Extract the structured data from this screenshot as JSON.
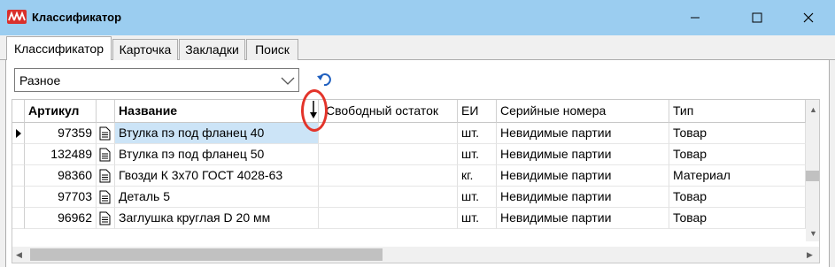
{
  "window": {
    "title": "Классификатор"
  },
  "tabs": [
    {
      "label": "Классификатор",
      "active": true
    },
    {
      "label": "Карточка",
      "active": false
    },
    {
      "label": "Закладки",
      "active": false
    },
    {
      "label": "Поиск",
      "active": false
    }
  ],
  "filter": {
    "selected": "Разное"
  },
  "grid": {
    "columns": [
      "Артикул",
      "",
      "Название",
      "Свободный остаток",
      "ЕИ",
      "Серийные номера",
      "Тип"
    ],
    "rows": [
      {
        "article": "97359",
        "name": "Втулка пэ под фланец 40",
        "stock": "",
        "unit": "шт.",
        "serial": "Невидимые партии",
        "type": "Товар",
        "current": true
      },
      {
        "article": "132489",
        "name": "Втулка пэ под фланец 50",
        "stock": "",
        "unit": "шт.",
        "serial": "Невидимые партии",
        "type": "Товар",
        "current": false
      },
      {
        "article": "98360",
        "name": "Гвозди К 3х70 ГОСТ 4028-63",
        "stock": "",
        "unit": "кг.",
        "serial": "Невидимые партии",
        "type": "Материал",
        "current": false
      },
      {
        "article": "97703",
        "name": "Деталь 5",
        "stock": "",
        "unit": "шт.",
        "serial": "Невидимые партии",
        "type": "Товар",
        "current": false
      },
      {
        "article": "96962",
        "name": "Заглушка круглая D 20 мм",
        "stock": "",
        "unit": "шт.",
        "serial": "Невидимые партии",
        "type": "Товар",
        "current": false
      }
    ]
  },
  "icons": {
    "app": "app-logo-icon",
    "minimize": "minimize-icon",
    "maximize": "maximize-icon",
    "close": "close-icon",
    "dropdown": "chevron-down-icon",
    "refresh": "undo-refresh-icon",
    "document": "document-icon",
    "row_pointer": "row-pointer-icon",
    "sort": "sort-down-arrow-icon"
  },
  "colors": {
    "titlebar": "#9bcdf0",
    "selection": "#cce4f7",
    "highlight_circle": "#e3342a",
    "app_icon": "#d9302c"
  }
}
